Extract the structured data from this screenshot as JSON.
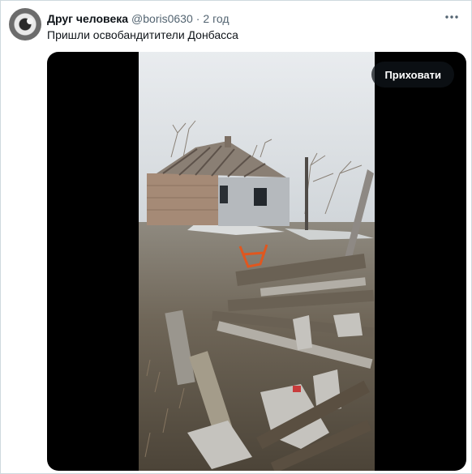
{
  "tweet": {
    "author_name": "Друг человека",
    "author_handle": "@boris0630",
    "separator": "·",
    "time": "2 год",
    "text": "Пришли освобандитители Донбасса"
  },
  "media": {
    "hide_button_label": "Приховати"
  },
  "icons": {
    "more": "more-horizontal-icon",
    "avatar": "avatar"
  }
}
